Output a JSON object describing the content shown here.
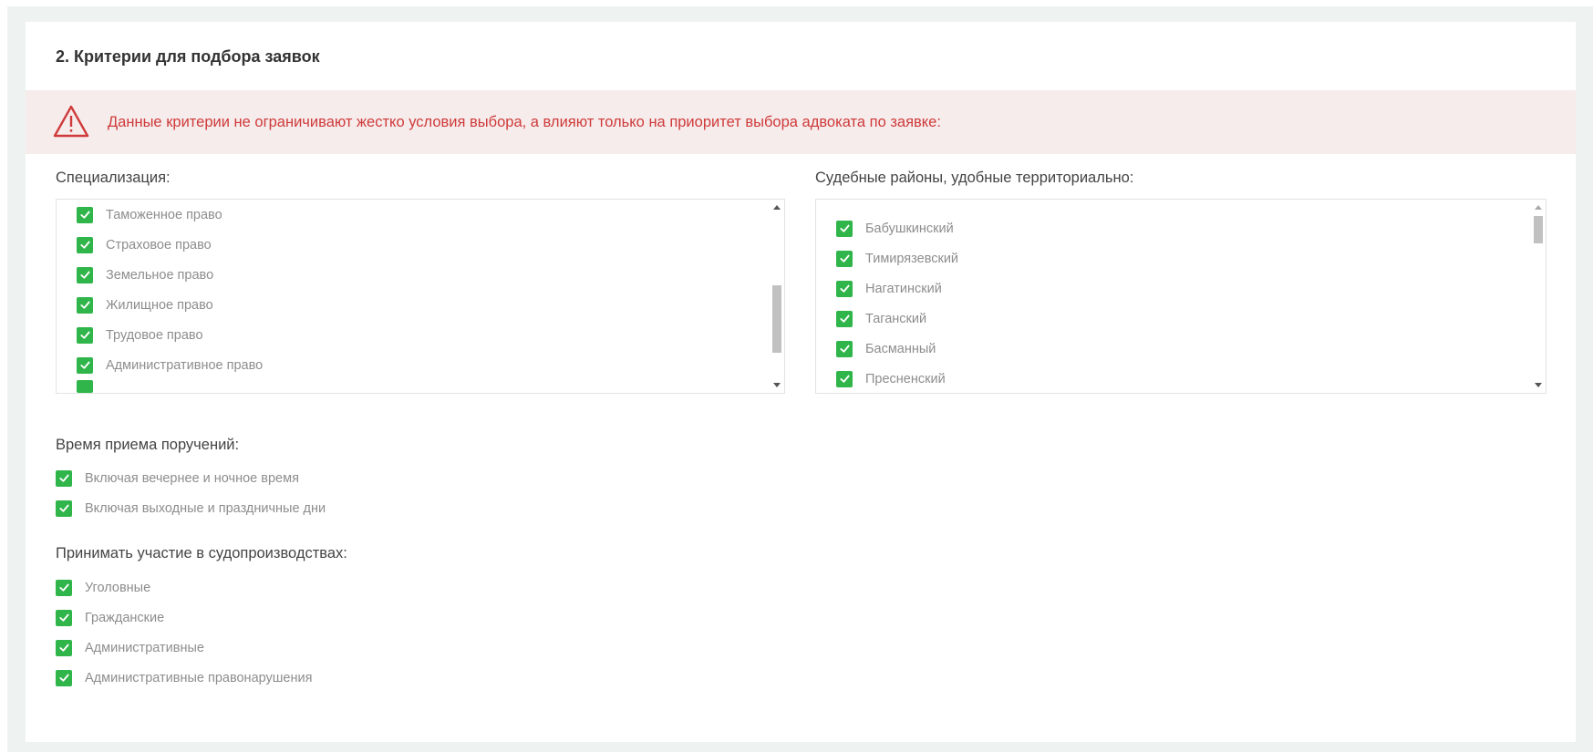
{
  "card": {
    "title": "2. Критерии для подбора заявок"
  },
  "alert": {
    "icon": "warning-triangle-icon",
    "text": "Данные критерии не ограничивают жестко условия выбора, а влияют только на приоритет выбора адвоката по заявке:",
    "color": "#cf3a3a"
  },
  "specialization": {
    "label": "Специализация:",
    "items": [
      {
        "label": "Таможенное право",
        "checked": true
      },
      {
        "label": "Страховое право",
        "checked": true
      },
      {
        "label": "Земельное право",
        "checked": true
      },
      {
        "label": "Жилищное право",
        "checked": true
      },
      {
        "label": "Трудовое право",
        "checked": true
      },
      {
        "label": "Административное право",
        "checked": true
      }
    ]
  },
  "districts": {
    "label": "Судебные районы, удобные территориально:",
    "items": [
      {
        "label": "Бабушкинский",
        "checked": true
      },
      {
        "label": "Тимирязевский",
        "checked": true
      },
      {
        "label": "Нагатинский",
        "checked": true
      },
      {
        "label": "Таганский",
        "checked": true
      },
      {
        "label": "Басманный",
        "checked": true
      },
      {
        "label": "Пресненский",
        "checked": true
      }
    ]
  },
  "reception_time": {
    "label": "Время приема поручений:",
    "items": [
      {
        "label": "Включая вечернее и ночное время",
        "checked": true
      },
      {
        "label": "Включая выходные и праздничные дни",
        "checked": true
      }
    ]
  },
  "proceedings": {
    "label": "Принимать участие в судопроизводствах:",
    "items": [
      {
        "label": "Уголовные",
        "checked": true
      },
      {
        "label": "Гражданские",
        "checked": true
      },
      {
        "label": "Административные",
        "checked": true
      },
      {
        "label": "Административные правонарушения",
        "checked": true
      }
    ]
  },
  "colors": {
    "checkbox": "#2fb54a",
    "background": "#eef3f1"
  }
}
